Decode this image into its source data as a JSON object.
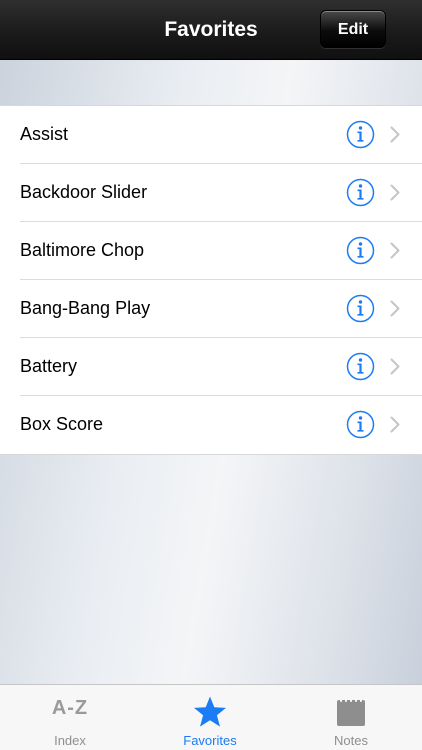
{
  "navbar": {
    "title": "Favorites",
    "edit_label": "Edit"
  },
  "favorites": [
    {
      "label": "Assist",
      "info_icon": "info-icon",
      "chevron_icon": "chevron-right-icon"
    },
    {
      "label": "Backdoor Slider",
      "info_icon": "info-icon",
      "chevron_icon": "chevron-right-icon"
    },
    {
      "label": "Baltimore Chop",
      "info_icon": "info-icon",
      "chevron_icon": "chevron-right-icon"
    },
    {
      "label": "Bang-Bang Play",
      "info_icon": "info-icon",
      "chevron_icon": "chevron-right-icon"
    },
    {
      "label": "Battery",
      "info_icon": "info-icon",
      "chevron_icon": "chevron-right-icon"
    },
    {
      "label": "Box Score",
      "info_icon": "info-icon",
      "chevron_icon": "chevron-right-icon"
    }
  ],
  "tabbar": {
    "tabs": [
      {
        "label": "Index",
        "icon": "a-z-icon",
        "icon_text": "A-Z",
        "selected": false
      },
      {
        "label": "Favorites",
        "icon": "star-icon",
        "selected": true
      },
      {
        "label": "Notes",
        "icon": "notepad-icon",
        "selected": false
      }
    ]
  },
  "colors": {
    "accent": "#1c7cf4",
    "navbar": "#1b1b1b",
    "tab_inactive": "#8e8e8e"
  }
}
